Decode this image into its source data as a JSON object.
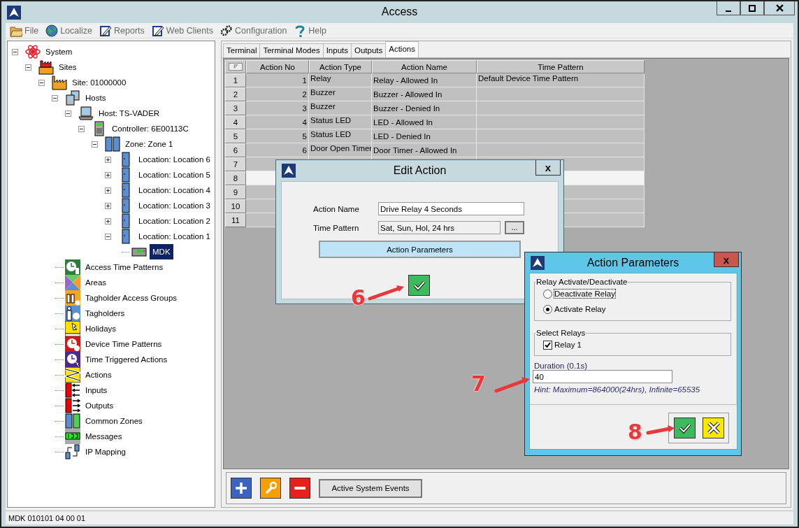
{
  "window": {
    "title": "Access"
  },
  "menu": [
    {
      "label": "File",
      "kind": "file"
    },
    {
      "label": "Localize",
      "kind": "localize"
    },
    {
      "label": "Reports",
      "kind": "reports"
    },
    {
      "label": "Web Clients",
      "kind": "web"
    },
    {
      "label": "Configuration",
      "kind": "config"
    },
    {
      "label": "Help",
      "kind": "help"
    }
  ],
  "tree": [
    {
      "label": "System",
      "kind": "system",
      "expanded": true,
      "selected": false,
      "children": [
        {
          "label": "Sites",
          "kind": "sites",
          "expanded": true,
          "selected": false,
          "children": [
            {
              "label": "Site: 01000000",
              "kind": "site",
              "expanded": true,
              "selected": false,
              "children": [
                {
                  "label": "Hosts",
                  "kind": "hosts",
                  "expanded": true,
                  "selected": false,
                  "children": [
                    {
                      "label": "Host: TS-VADER",
                      "kind": "host",
                      "expanded": true,
                      "selected": false,
                      "children": [
                        {
                          "label": "Controller: 6E00113C",
                          "kind": "controller",
                          "expanded": true,
                          "selected": false,
                          "children": [
                            {
                              "label": "Zone: Zone 1",
                              "kind": "zone",
                              "expanded": true,
                              "selected": false,
                              "children": [
                                {
                                  "label": "Location: Location 6",
                                  "kind": "location",
                                  "expanded": false,
                                  "selected": false
                                },
                                {
                                  "label": "Location: Location 5",
                                  "kind": "location",
                                  "expanded": false,
                                  "selected": false
                                },
                                {
                                  "label": "Location: Location 4",
                                  "kind": "location",
                                  "expanded": false,
                                  "selected": false
                                },
                                {
                                  "label": "Location: Location 3",
                                  "kind": "location",
                                  "expanded": false,
                                  "selected": false
                                },
                                {
                                  "label": "Location: Location 2",
                                  "kind": "location",
                                  "expanded": false,
                                  "selected": false
                                },
                                {
                                  "label": "Location: Location 1",
                                  "kind": "location",
                                  "expanded": true,
                                  "selected": false,
                                  "children": [
                                    {
                                      "label": "MDK",
                                      "kind": "device",
                                      "selected": true
                                    }
                                  ]
                                }
                              ]
                            }
                          ]
                        }
                      ]
                    }
                  ]
                },
                {
                  "label": "Access Time Patterns",
                  "kind": "access_time_patterns",
                  "selected": false
                },
                {
                  "label": "Areas",
                  "kind": "areas",
                  "selected": false
                },
                {
                  "label": "Tagholder Access Groups",
                  "kind": "access_groups",
                  "selected": false
                },
                {
                  "label": "Tagholders",
                  "kind": "tagholders",
                  "selected": false
                },
                {
                  "label": "Holidays",
                  "kind": "holidays",
                  "selected": false
                },
                {
                  "label": "Device Time Patterns",
                  "kind": "device_time_patterns",
                  "selected": false
                },
                {
                  "label": "Time Triggered Actions",
                  "kind": "time_triggered_actions",
                  "selected": false
                },
                {
                  "label": "Actions",
                  "kind": "actions",
                  "selected": false
                },
                {
                  "label": "Inputs",
                  "kind": "inputs",
                  "selected": false
                },
                {
                  "label": "Outputs",
                  "kind": "outputs",
                  "selected": false
                },
                {
                  "label": "Common Zones",
                  "kind": "common_zones",
                  "selected": false
                },
                {
                  "label": "Messages",
                  "kind": "messages",
                  "selected": false
                },
                {
                  "label": "IP Mapping",
                  "kind": "ip_mapping",
                  "selected": false
                }
              ]
            }
          ]
        }
      ]
    }
  ],
  "tabs": [
    {
      "label": "Terminal",
      "selected": false
    },
    {
      "label": "Terminal Modes",
      "selected": false
    },
    {
      "label": "Inputs",
      "selected": false
    },
    {
      "label": "Outputs",
      "selected": false
    },
    {
      "label": "Actions",
      "selected": true
    }
  ],
  "table": {
    "columns": [
      "Action No",
      "Action Type",
      "Action Name",
      "Time Pattern"
    ],
    "rows": [
      {
        "number": "1",
        "action_no": "1",
        "action_type": "Relay",
        "action_name": "Relay - Allowed In",
        "time_pattern": "Default Device Time Pattern",
        "selected": false
      },
      {
        "number": "2",
        "action_no": "2",
        "action_type": "Buzzer",
        "action_name": "Buzzer - Allowed In",
        "selected": false
      },
      {
        "number": "3",
        "action_no": "3",
        "action_type": "Buzzer",
        "action_name": "Buzzer - Denied In",
        "selected": false
      },
      {
        "number": "4",
        "action_no": "4",
        "action_type": "Status LED",
        "action_name": "LED - Allowed In",
        "selected": false
      },
      {
        "number": "5",
        "action_no": "5",
        "action_type": "Status LED",
        "action_name": "LED - Denied In",
        "selected": false
      },
      {
        "number": "6",
        "action_no": "6",
        "action_type": "Door Open Timer",
        "action_name": "Door Timer - Allowed In",
        "selected": false
      },
      {
        "number": "7",
        "selected": false
      },
      {
        "number": "8",
        "selected": true
      },
      {
        "number": "9",
        "selected": false
      },
      {
        "number": "10",
        "selected": false
      },
      {
        "number": "11",
        "selected": false
      }
    ]
  },
  "toolbar": {
    "button": "Active System Events"
  },
  "status_bar": "MDK 010101 04 00 01",
  "edit_action": {
    "title": "Edit Action",
    "close": "x",
    "action_name_label": "Action Name",
    "action_name": "Drive Relay 4 Seconds",
    "time_pattern_label": "Time Pattern",
    "time_pattern": "Sat, Sun, Hol, 24 hrs",
    "browse": "...",
    "parameters_button": "Action Parameters"
  },
  "action_parameters": {
    "title": "Action Parameters",
    "close": "x",
    "relay_group": "Relay Activate/Deactivate",
    "radios": [
      {
        "label": "Deactivate Relay",
        "selected": false,
        "focused": true
      },
      {
        "label": "Activate Relay",
        "selected": true,
        "focused": false
      }
    ],
    "select_group": "Select Relays",
    "relays": [
      {
        "label": "Relay 1",
        "checked": true
      }
    ],
    "duration_label": "Duration (0.1s)",
    "duration": "40",
    "hint": "Hint: Maximum=864000(24hrs), Infinite=65535"
  },
  "callouts": [
    {
      "label": "6"
    },
    {
      "label": "7"
    },
    {
      "label": "8"
    }
  ]
}
